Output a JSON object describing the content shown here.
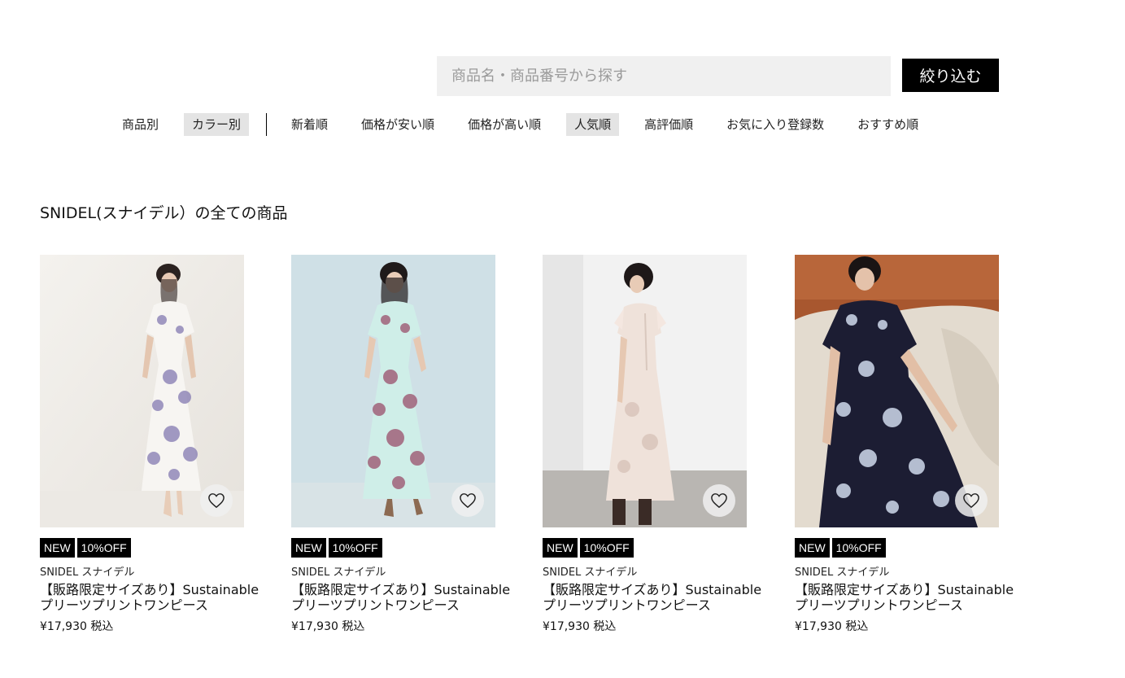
{
  "search": {
    "placeholder": "商品名・商品番号から探す",
    "button_label": "絞り込む"
  },
  "filters": {
    "group": [
      "商品別",
      "カラー別"
    ],
    "sort": [
      "新着順",
      "価格が安い順",
      "価格が高い順",
      "人気順",
      "高評価順",
      "お気に入り登録数",
      "おすすめ順"
    ],
    "active": [
      "カラー別",
      "人気順"
    ]
  },
  "page_title": "SNIDEL(スナイデル）の全ての商品",
  "products": [
    {
      "image_icon": "white-lilac-floral-dress-photo",
      "badges": [
        "NEW",
        "10%OFF"
      ],
      "brand": "SNIDEL スナイデル",
      "name_line1": "【販路限定サイズあり】Sustainable",
      "name_line2": "プリーツプリントワンピース",
      "price": "¥17,930 税込"
    },
    {
      "image_icon": "mint-pink-floral-dress-photo",
      "badges": [
        "NEW",
        "10%OFF"
      ],
      "brand": "SNIDEL スナイデル",
      "name_line1": "【販路限定サイズあり】Sustainable",
      "name_line2": "プリーツプリントワンピース",
      "price": "¥17,930 税込"
    },
    {
      "image_icon": "beige-floral-dress-back-view-photo",
      "badges": [
        "NEW",
        "10%OFF"
      ],
      "brand": "SNIDEL スナイデル",
      "name_line1": "【販路限定サイズあり】Sustainable",
      "name_line2": "プリーツプリントワンピース",
      "price": "¥17,930 税込"
    },
    {
      "image_icon": "navy-floral-dress-seated-photo",
      "badges": [
        "NEW",
        "10%OFF"
      ],
      "brand": "SNIDEL スナイデル",
      "name_line1": "【販路限定サイズあり】Sustainable",
      "name_line2": "プリーツプリントワンピース",
      "price": "¥17,930 税込"
    }
  ],
  "colors": {
    "badge_bg": "#000000",
    "search_bg": "#f0f0f0",
    "active_chip_bg": "#e4e4e4"
  }
}
